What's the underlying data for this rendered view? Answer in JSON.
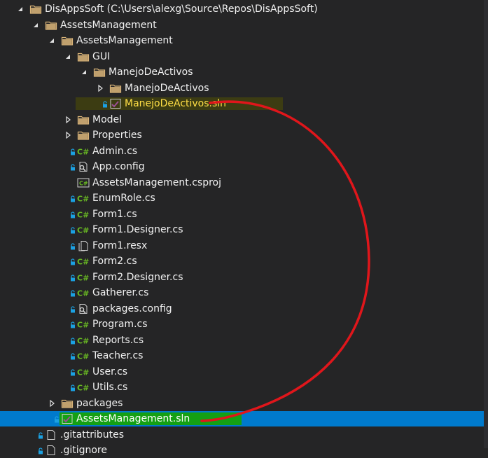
{
  "solution": {
    "label": "DisAppsSoft (C:\\Users\\alexg\\Source\\Repos\\DisAppsSoft)",
    "icon": "folder-icon"
  },
  "tree": [
    {
      "label": "AssetsManagement",
      "icon": "folder-icon",
      "expander": "expanded"
    },
    {
      "label": "AssetsManagement",
      "icon": "folder-icon",
      "expander": "expanded"
    },
    {
      "label": "GUI",
      "icon": "folder-icon",
      "expander": "expanded"
    },
    {
      "label": "ManejoDeActivos",
      "icon": "folder-icon",
      "expander": "expanded"
    },
    {
      "label": "ManejoDeActivos",
      "icon": "folder-icon",
      "expander": "collapsed"
    },
    {
      "label": "ManejoDeActivos.sln",
      "icon": "solution-file-icon",
      "locked": true,
      "highlight": "yellow"
    },
    {
      "label": "Model",
      "icon": "folder-icon",
      "expander": "collapsed"
    },
    {
      "label": "Properties",
      "icon": "folder-icon",
      "expander": "collapsed"
    },
    {
      "label": "Admin.cs",
      "icon": "csharp-file-icon",
      "locked": true
    },
    {
      "label": "App.config",
      "icon": "config-file-icon",
      "locked": true
    },
    {
      "label": "AssetsManagement.csproj",
      "icon": "csharp-project-icon"
    },
    {
      "label": "EnumRole.cs",
      "icon": "csharp-file-icon",
      "locked": true
    },
    {
      "label": "Form1.cs",
      "icon": "csharp-file-icon",
      "locked": true
    },
    {
      "label": "Form1.Designer.cs",
      "icon": "csharp-file-icon",
      "locked": true
    },
    {
      "label": "Form1.resx",
      "icon": "resx-file-icon",
      "locked": true
    },
    {
      "label": "Form2.cs",
      "icon": "csharp-file-icon",
      "locked": true
    },
    {
      "label": "Form2.Designer.cs",
      "icon": "csharp-file-icon",
      "locked": true
    },
    {
      "label": "Gatherer.cs",
      "icon": "csharp-file-icon",
      "locked": true
    },
    {
      "label": "packages.config",
      "icon": "config-file-icon",
      "locked": true
    },
    {
      "label": "Program.cs",
      "icon": "csharp-file-icon",
      "locked": true
    },
    {
      "label": "Reports.cs",
      "icon": "csharp-file-icon",
      "locked": true
    },
    {
      "label": "Teacher.cs",
      "icon": "csharp-file-icon",
      "locked": true
    },
    {
      "label": "User.cs",
      "icon": "csharp-file-icon",
      "locked": true
    },
    {
      "label": "Utils.cs",
      "icon": "csharp-file-icon",
      "locked": true
    },
    {
      "label": "packages",
      "icon": "folder-icon",
      "expander": "collapsed"
    },
    {
      "label": "AssetsManagement.sln",
      "icon": "solution-file-icon",
      "locked": true,
      "highlight": "green",
      "selected": true
    },
    {
      "label": ".gitattributes",
      "icon": "file-icon",
      "locked": true
    },
    {
      "label": ".gitignore",
      "icon": "file-icon",
      "locked": true
    }
  ],
  "colors": {
    "background": "#252526",
    "text": "#f1f1f1",
    "selection": "#007acc",
    "folder": "#dcb67a",
    "csharp": "#68b723",
    "lock": "#1ba1e2",
    "yellow_text": "#ffde46",
    "yellow_highlight": "#3c3c12",
    "green_highlight": "#14a014",
    "annotation": "#e0161b"
  }
}
